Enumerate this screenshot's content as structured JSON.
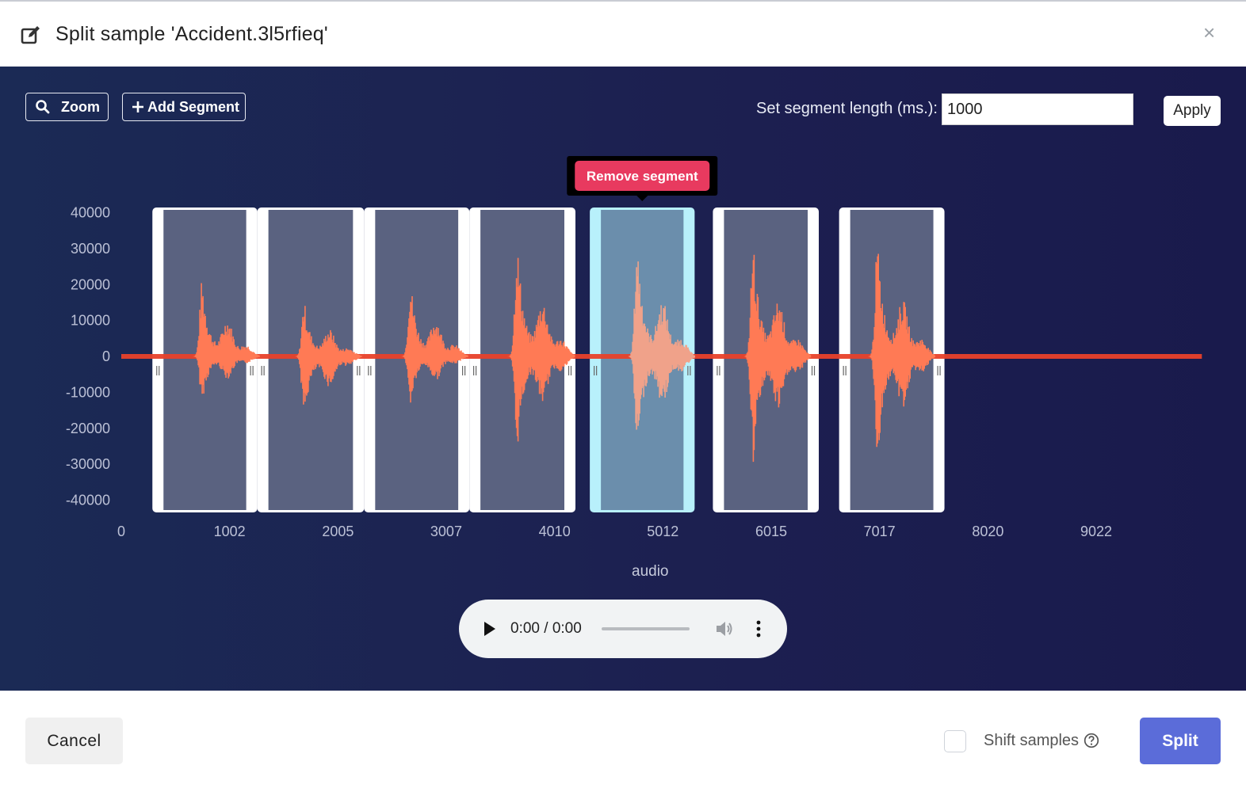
{
  "dialog": {
    "title": "Split sample 'Accident.3l5rfieq'",
    "close_symbol": "×",
    "edit_icon": "edit-icon",
    "close_icon": "close-icon"
  },
  "toolbar": {
    "zoom_label": "Zoom",
    "zoom_icon": "search-icon",
    "add_segment_label": "Add Segment",
    "add_icon": "plus-icon",
    "segment_length_label": "Set segment length (ms.):",
    "segment_length_value": "1000",
    "apply_label": "Apply"
  },
  "tooltip": {
    "remove_segment_label": "Remove segment"
  },
  "chart_data": {
    "type": "line",
    "title": "",
    "xlabel": "",
    "ylabel": "",
    "y_ticks": [
      "40000",
      "30000",
      "20000",
      "10000",
      "0",
      "-10000",
      "-20000",
      "-30000",
      "-40000"
    ],
    "x_ticks": [
      "0",
      "1002",
      "2005",
      "3007",
      "4010",
      "5012",
      "6015",
      "7017",
      "8020",
      "9022"
    ],
    "xlim": [
      0,
      10000
    ],
    "ylim": [
      -40000,
      40000
    ],
    "series": [
      {
        "name": "audio",
        "color": "#ff7a55",
        "baseline_color": "#e8412a"
      }
    ],
    "bursts": [
      {
        "x": 749,
        "peak": 22000,
        "trough": -13000
      },
      {
        "x": 1694,
        "peak": 16000,
        "trough": -18000
      },
      {
        "x": 2677,
        "peak": 22000,
        "trough": -14000
      },
      {
        "x": 3665,
        "peak": 33000,
        "trough": -27000
      },
      {
        "x": 4776,
        "peak": 33000,
        "trough": -28000
      },
      {
        "x": 5849,
        "peak": 33000,
        "trough": -32000
      },
      {
        "x": 6999,
        "peak": 33000,
        "trough": -30000
      }
    ],
    "segments": [
      {
        "start": 288,
        "end": 1259,
        "selected": false
      },
      {
        "start": 1259,
        "end": 2247,
        "selected": false
      },
      {
        "start": 2247,
        "end": 3221,
        "selected": false
      },
      {
        "start": 3221,
        "end": 4203,
        "selected": false
      },
      {
        "start": 4336,
        "end": 5306,
        "selected": true
      },
      {
        "start": 5475,
        "end": 6455,
        "selected": false
      },
      {
        "start": 6643,
        "end": 7618,
        "selected": false
      }
    ],
    "legend": {
      "label": "audio",
      "placement": "bottom-center"
    },
    "colors": {
      "segment_fill": "#5a6280",
      "selected_fill": "#6b8eac",
      "selected_border": "#b8f0fb",
      "tick_label": "#bcc1d6"
    }
  },
  "player": {
    "time": "0:00 / 0:00",
    "play_icon": "play-icon",
    "volume_icon": "volume-icon",
    "more_icon": "more-vert-icon"
  },
  "footer": {
    "cancel_label": "Cancel",
    "shift_samples_label": "Shift samples",
    "help_icon": "help-circle-icon",
    "split_label": "Split",
    "accent": "#5b6cd9"
  }
}
